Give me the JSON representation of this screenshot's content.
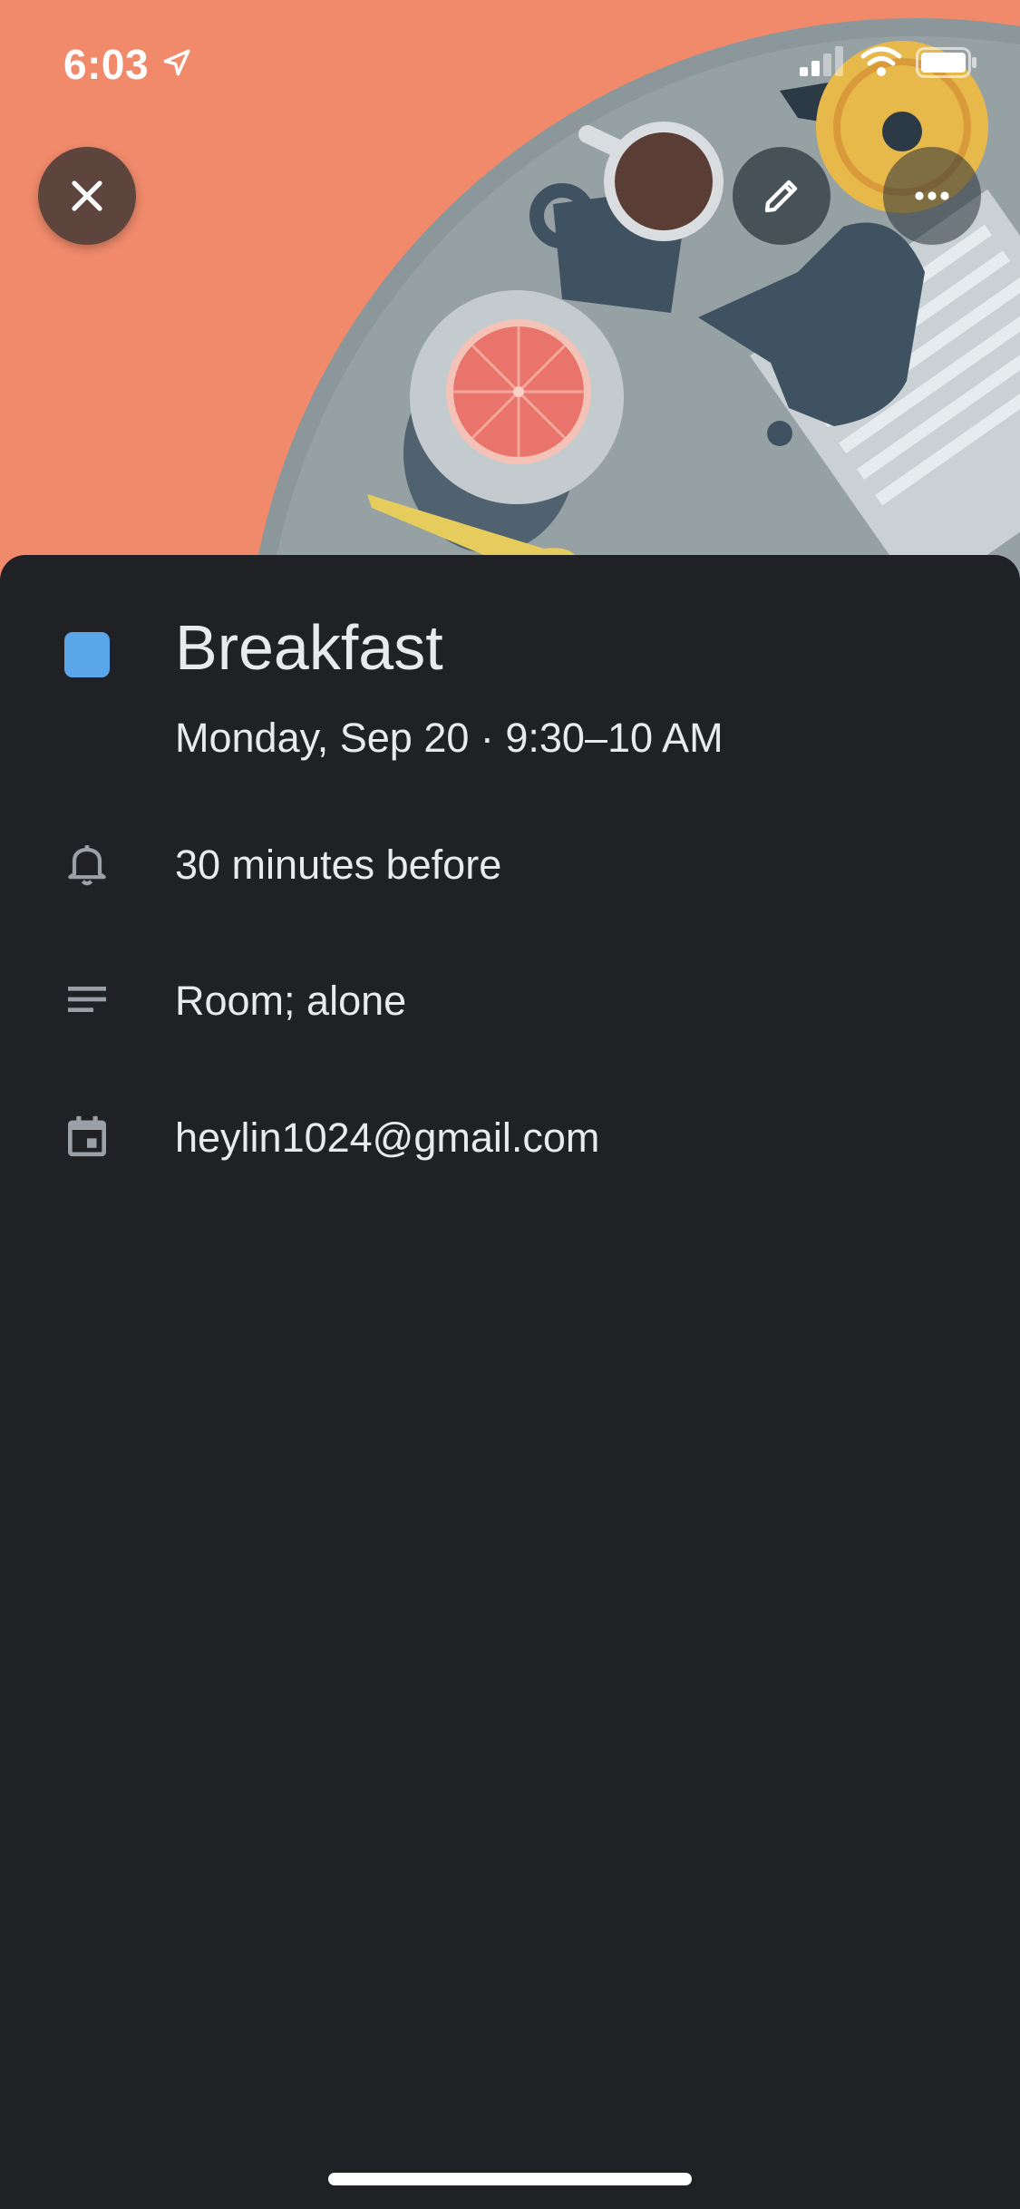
{
  "status_bar": {
    "time": "6:03"
  },
  "header": {
    "illustration": "breakfast-table-illustration",
    "background_color": "#f08a6b",
    "buttons": {
      "close_icon": "close-icon",
      "edit_icon": "pencil-icon",
      "more_icon": "more-horizontal-icon"
    }
  },
  "event": {
    "color": "#5ba6e8",
    "title": "Breakfast",
    "datetime": "Monday, Sep 20 · 9:30–10 AM",
    "reminder": "30 minutes before",
    "description": "Room; alone",
    "calendar": "heylin1024@gmail.com"
  },
  "icons": {
    "reminder": "bell-icon",
    "description": "notes-icon",
    "calendar": "calendar-icon"
  }
}
